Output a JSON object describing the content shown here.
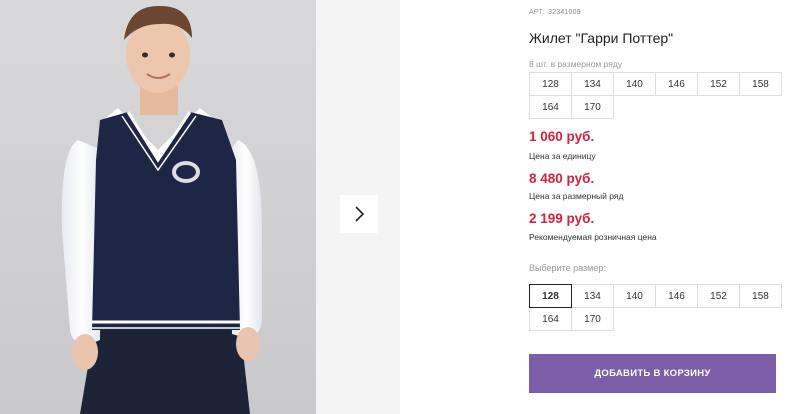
{
  "product": {
    "sku_label": "АРТ:",
    "sku": "32341009",
    "title": "Жилет \"Гарри Поттер\"",
    "pack_note": "8 шт. в размерном ряду",
    "pack_sizes": [
      "128",
      "134",
      "140",
      "146",
      "152",
      "158",
      "164",
      "170"
    ]
  },
  "prices": [
    {
      "value": "1 060 руб.",
      "label": "Цена за единицу"
    },
    {
      "value": "8 480 руб.",
      "label": "Цена за размерный ряд"
    },
    {
      "value": "2 199 руб.",
      "label": "Рекомендуемая розничная цена"
    }
  ],
  "size_select": {
    "label": "Выберите размер:",
    "options": [
      "128",
      "134",
      "140",
      "146",
      "152",
      "158",
      "164",
      "170"
    ],
    "selected": "128"
  },
  "actions": {
    "add_to_cart": "ДОБАВИТЬ В КОРЗИНУ"
  },
  "icons": {
    "next": "chevron-right-icon"
  },
  "colors": {
    "price": "#d6213a",
    "button": "#7b5ea7",
    "gallery_side": "#f4f4f4"
  }
}
